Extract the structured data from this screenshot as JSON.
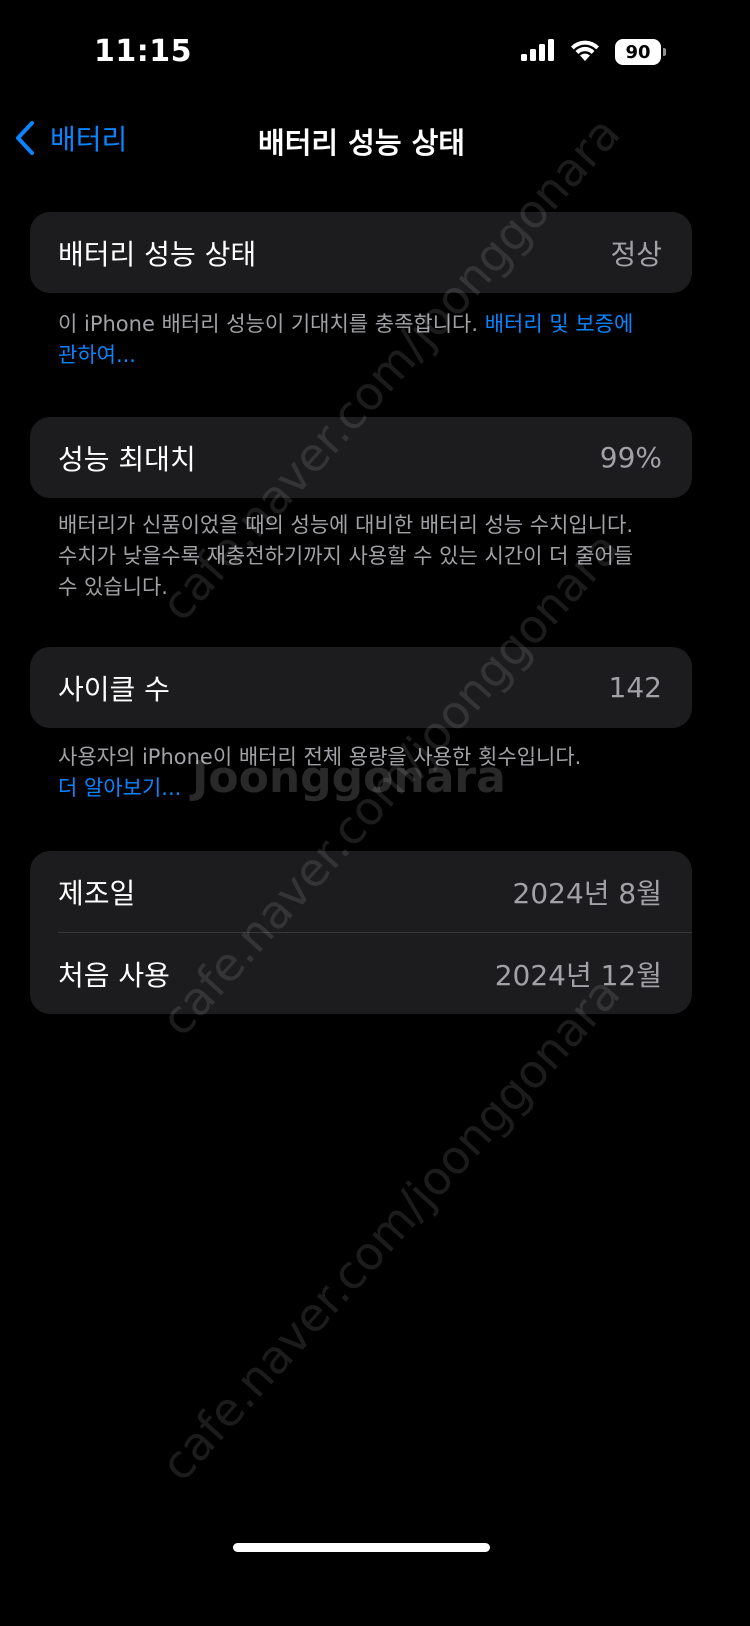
{
  "status_bar": {
    "time": "11:15",
    "battery_level": "90",
    "icons": [
      "cellular-signal-icon",
      "wifi-icon",
      "battery-icon"
    ]
  },
  "nav": {
    "back_label": "배터리",
    "title": "배터리 성능 상태"
  },
  "health": {
    "label": "배터리 성능 상태",
    "value": "정상",
    "note_text": "이 iPhone 배터리 성능이 기대치를 충족합니다. ",
    "note_link": "배터리 및 보증에 관하여..."
  },
  "max_capacity": {
    "label": "성능 최대치",
    "value": "99%",
    "note_text": "배터리가 신품이었을 때의 성능에 대비한 배터리 성능 수치입니다. 수치가 낮을수록 재충전하기까지 사용할 수 있는 시간이 더 줄어들 수 있습니다."
  },
  "cycle_count": {
    "label": "사이클 수",
    "value": "142",
    "note_text": "사용자의 iPhone이 배터리 전체 용량을 사용한 횟수입니다.",
    "note_link": "더 알아보기..."
  },
  "dates": {
    "manufacture_label": "제조일",
    "manufacture_value": "2024년 8월",
    "first_use_label": "처음 사용",
    "first_use_value": "2024년 12월"
  },
  "watermark": {
    "text": "cafe.naver.com/joonggonara",
    "logo": "Joonggonara"
  },
  "colors": {
    "background": "#000000",
    "card": "#1c1c1e",
    "accent": "#0a84ff",
    "secondary_text": "#a1a1a6"
  }
}
